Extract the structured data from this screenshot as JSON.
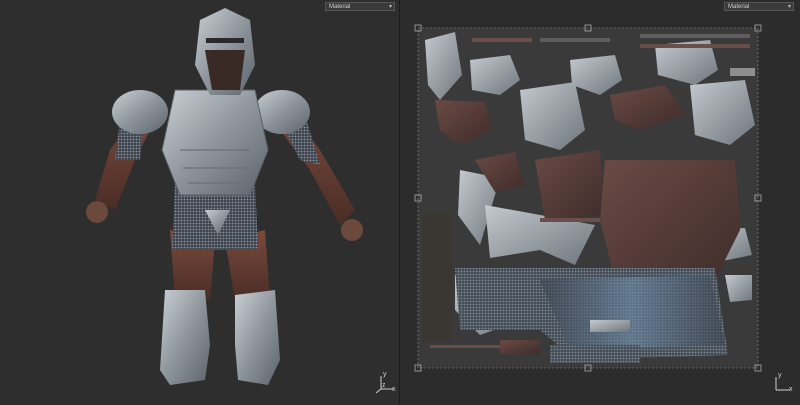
{
  "viewport3d": {
    "material_dropdown": {
      "selected": "Material",
      "icon": "chevron-down-icon"
    },
    "axis_labels": {
      "x": "x",
      "y": "y",
      "z": "z"
    }
  },
  "uv_editor": {
    "material_dropdown": {
      "selected": "Material",
      "icon": "chevron-down-icon"
    },
    "axis_labels": {
      "x": "x",
      "y": "y"
    }
  },
  "colors": {
    "background": "#2e2e2e",
    "metal": "#9aa3ab",
    "chainmail": "#5b6a78",
    "skin": "#6b4a3c"
  }
}
